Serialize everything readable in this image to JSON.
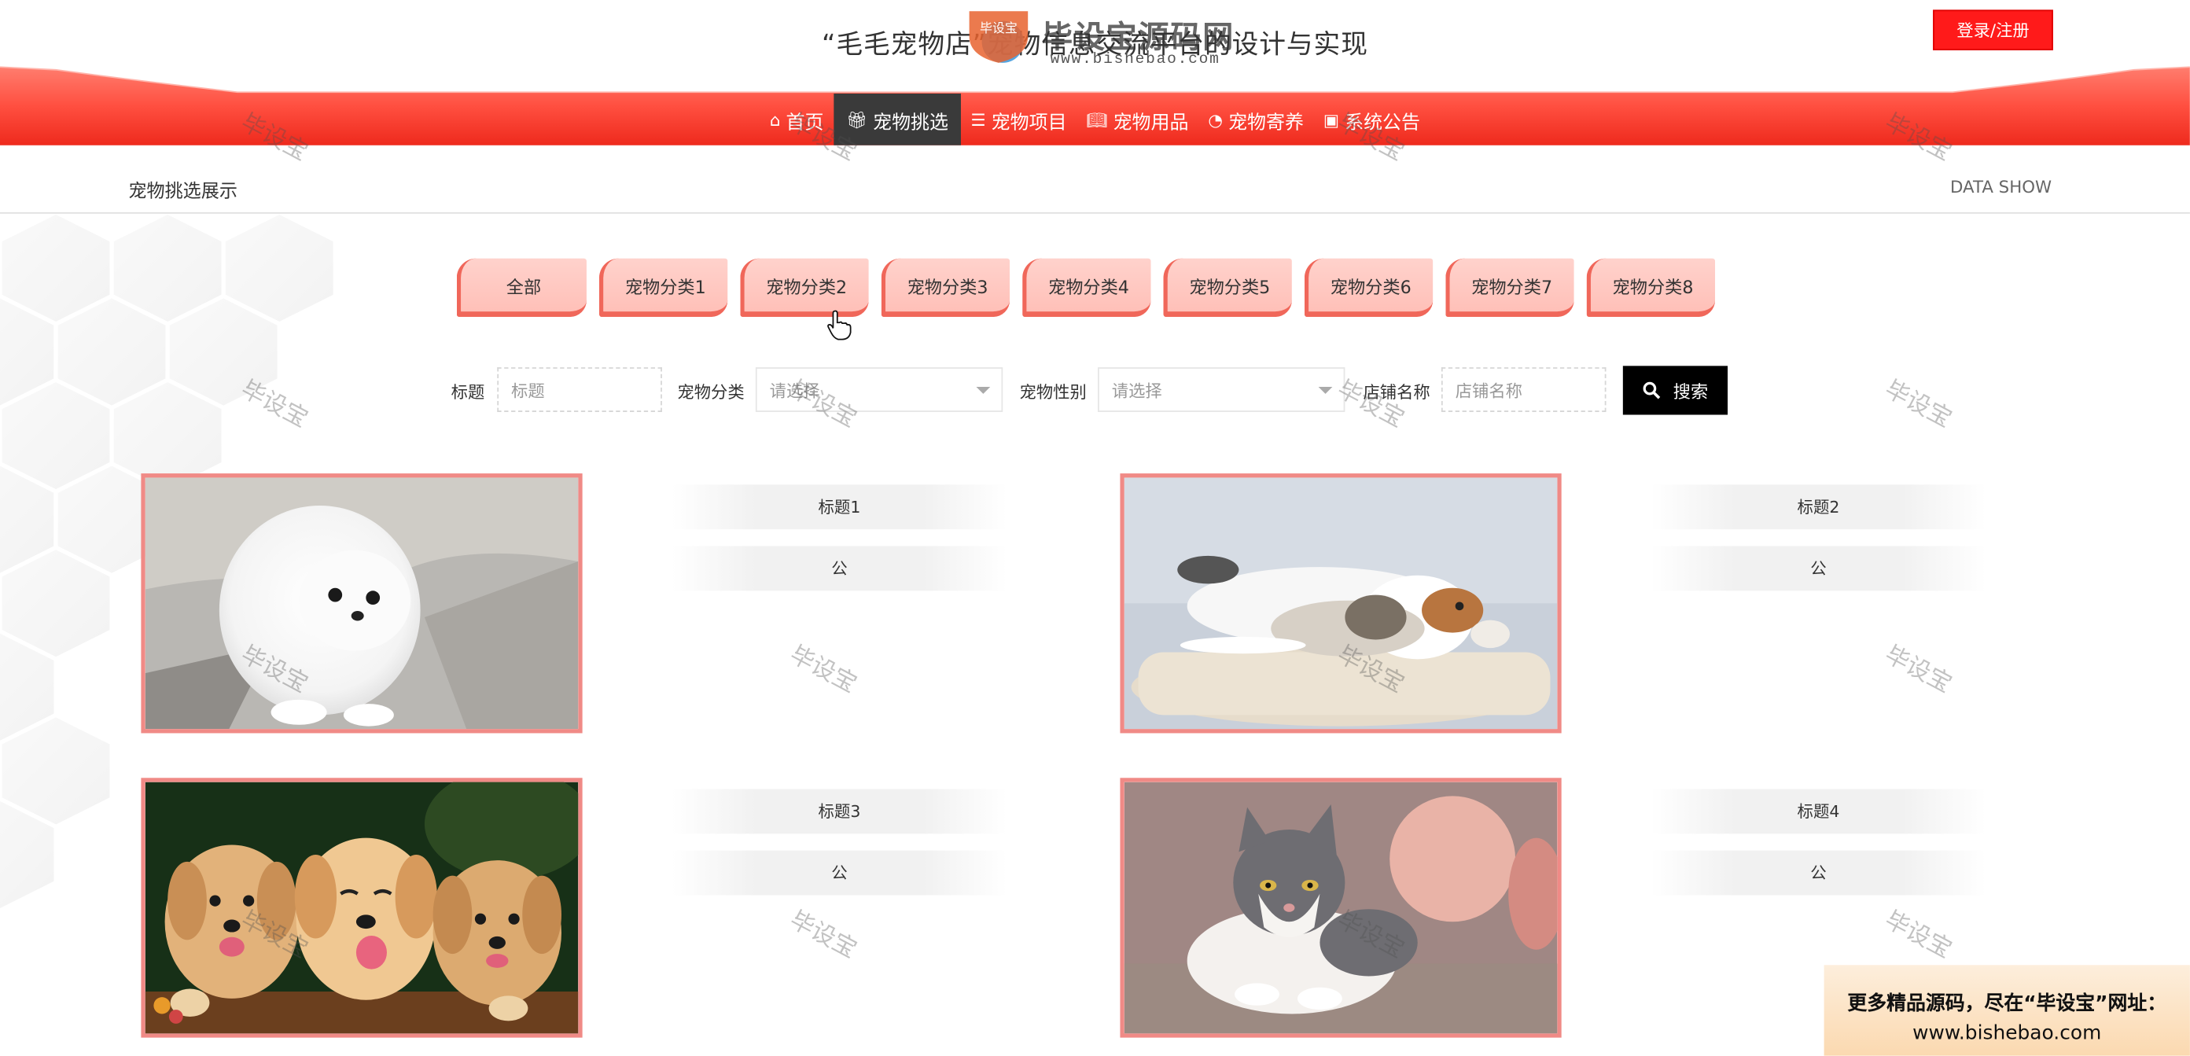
{
  "header": {
    "site_title": "“毛毛宠物店”宠物信息交流平台的设计与实现",
    "login_label": "登录/注册",
    "watermark_brand": "毕设宝源码网",
    "watermark_url": "www.bishebao.com",
    "watermark_shield_text": "毕设宝"
  },
  "nav": [
    {
      "label": "首页",
      "icon": "home-icon"
    },
    {
      "label": "宠物挑选",
      "icon": "gift-icon",
      "active": true
    },
    {
      "label": "宠物项目",
      "icon": "sliders-icon"
    },
    {
      "label": "宠物用品",
      "icon": "book-icon"
    },
    {
      "label": "宠物寄养",
      "icon": "palette-icon"
    },
    {
      "label": "系统公告",
      "icon": "news-icon"
    }
  ],
  "section": {
    "title": "宠物挑选展示",
    "subtitle": "DATA SHOW"
  },
  "category_tabs": [
    "全部",
    "宠物分类1",
    "宠物分类2",
    "宠物分类3",
    "宠物分类4",
    "宠物分类5",
    "宠物分类6",
    "宠物分类7",
    "宠物分类8"
  ],
  "search": {
    "title_label": "标题",
    "title_placeholder": "标题",
    "category_label": "宠物分类",
    "category_value": "请选择",
    "gender_label": "宠物性别",
    "gender_value": "请选择",
    "shop_label": "店铺名称",
    "shop_placeholder": "店铺名称",
    "button_label": "搜索"
  },
  "cards": [
    {
      "title": "标题1",
      "sub": "公",
      "image": "white-pomeranian-puppy"
    },
    {
      "title": "标题2",
      "sub": "公",
      "image": "cat-and-dog-sleeping"
    },
    {
      "title": "标题3",
      "sub": "公",
      "image": "three-golden-retriever-puppies"
    },
    {
      "title": "标题4",
      "sub": "公",
      "image": "grey-white-cat-lying"
    }
  ],
  "watermark_text": "毕设宝",
  "promo": {
    "line1": "更多精品源码，尽在“毕设宝”网址：",
    "line2": "www.bishebao.com"
  },
  "colors": {
    "nav_red": "#ff4a3d",
    "nav_active": "#3a3a3a",
    "login_red": "#ff1a1a",
    "tab_pink": "#ffc6bf",
    "tab_edge": "#f0675a",
    "card_border": "#f08a86",
    "search_button": "#000000"
  }
}
